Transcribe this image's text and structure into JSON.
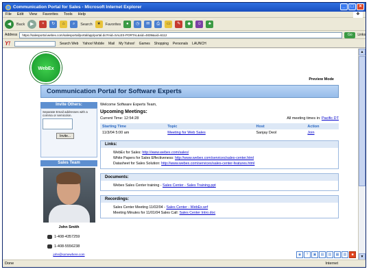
{
  "window": {
    "title": "Communication Portal for Sales - Microsoft Internet Explorer",
    "buttons": [
      "_",
      "□",
      "×"
    ]
  },
  "menubar": {
    "items": [
      "File",
      "Edit",
      "View",
      "Favorites",
      "Tools",
      "Help"
    ]
  },
  "toolbar": {
    "back_label": "Back",
    "search_label": "Search",
    "favorites_label": "Favorites"
  },
  "address": {
    "label": "Address",
    "url": "https://salesportal.webex.com/salesportal/portal/app/portal.do?mid=SALES-PORTAL&sid=4839&uid=6112",
    "go_label": "Go",
    "links_label": "Links"
  },
  "yahoo": {
    "logo": "Y!",
    "search_web_label": "Search Web",
    "items": [
      "Yahoo! Mobile",
      "Mail",
      "My Yahoo!",
      "Games",
      "Shopping",
      "Personals",
      "LAUNCH"
    ]
  },
  "page": {
    "logo_text": "WebEx",
    "preview_mode": "Preview Mode",
    "hero_title": "Communication Portal for Software Experts",
    "invite": {
      "header": "Invite Others:",
      "text": "Separate Email addresses with a comma or semicolon.",
      "button": "Invite..."
    },
    "sales_team": {
      "header": "Sales Team",
      "name": "John Smith",
      "phone": "1-408-4357259",
      "mobile": "1-408-5556238",
      "email": "john@somewhere.com"
    },
    "welcome": "Welcome Software Experts Team,",
    "upcoming_title": "Upcoming Meetings:",
    "current_time": "Current Time: 12:54:28",
    "timezone_label": "All meeting times in:",
    "timezone_value": "Pacific DT",
    "meetings": {
      "headers": [
        "Starting Time",
        "Topic",
        "Host",
        "Action"
      ],
      "rows": [
        {
          "time": "11/3/04 5:00 am",
          "topic": "Meeting for Web Sales",
          "host": "Sanjay Deol",
          "action": "Join"
        }
      ]
    },
    "links": {
      "header": "Links:",
      "items": [
        {
          "label": "WebEx for Sales:",
          "link": "http://www.webex.com/sales/"
        },
        {
          "label": "White Papers for Sales Effectiveness:",
          "link": "http://www.webex.com/services/sales-center.html"
        },
        {
          "label": "Datasheet for Sales Solution:",
          "link": "http://www.webex.com/services/sales-center-features.html"
        }
      ]
    },
    "documents": {
      "header": "Documents:",
      "items": [
        {
          "label": "Webex Sales Center training -",
          "link": "Sales Center - Sales Training.ppt"
        }
      ]
    },
    "recordings": {
      "header": "Recordings:",
      "items": [
        {
          "label": "Sales Center Meeting 11/02/04 -",
          "link": "Sales Center - WebEx.wrf"
        },
        {
          "label": "Meeting Minutes for 11/01/04 Sales Call:",
          "link": "Sales Center Intro.doc"
        }
      ]
    }
  },
  "status": {
    "left": "Done",
    "zone": "Internet"
  }
}
